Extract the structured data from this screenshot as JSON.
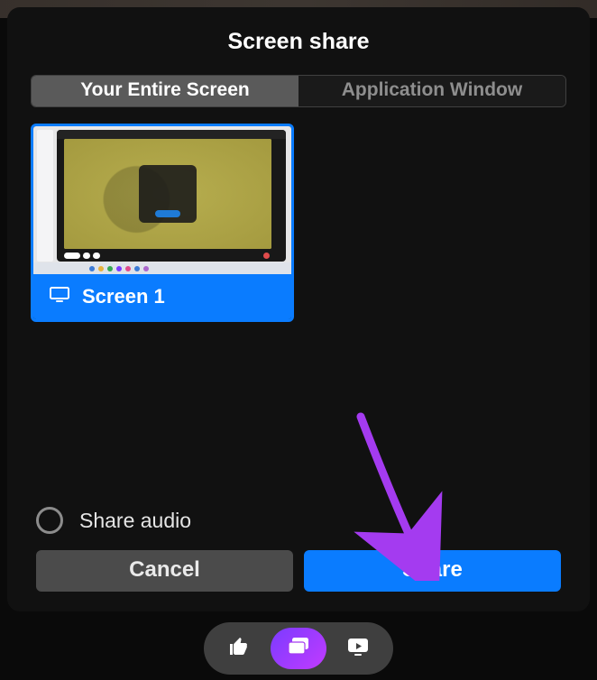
{
  "modal": {
    "title": "Screen share",
    "tabs": [
      {
        "label": "Your Entire Screen",
        "active": true
      },
      {
        "label": "Application Window",
        "active": false
      }
    ],
    "screens": [
      {
        "label": "Screen 1",
        "selected": true
      }
    ],
    "shareAudioLabel": "Share audio",
    "cancelLabel": "Cancel",
    "shareLabel": "Share"
  },
  "colors": {
    "accent": "#0a7cff",
    "arrow": "#a43bf0"
  },
  "toolbar": {
    "items": [
      "thumbs-up",
      "cast",
      "watch"
    ]
  }
}
